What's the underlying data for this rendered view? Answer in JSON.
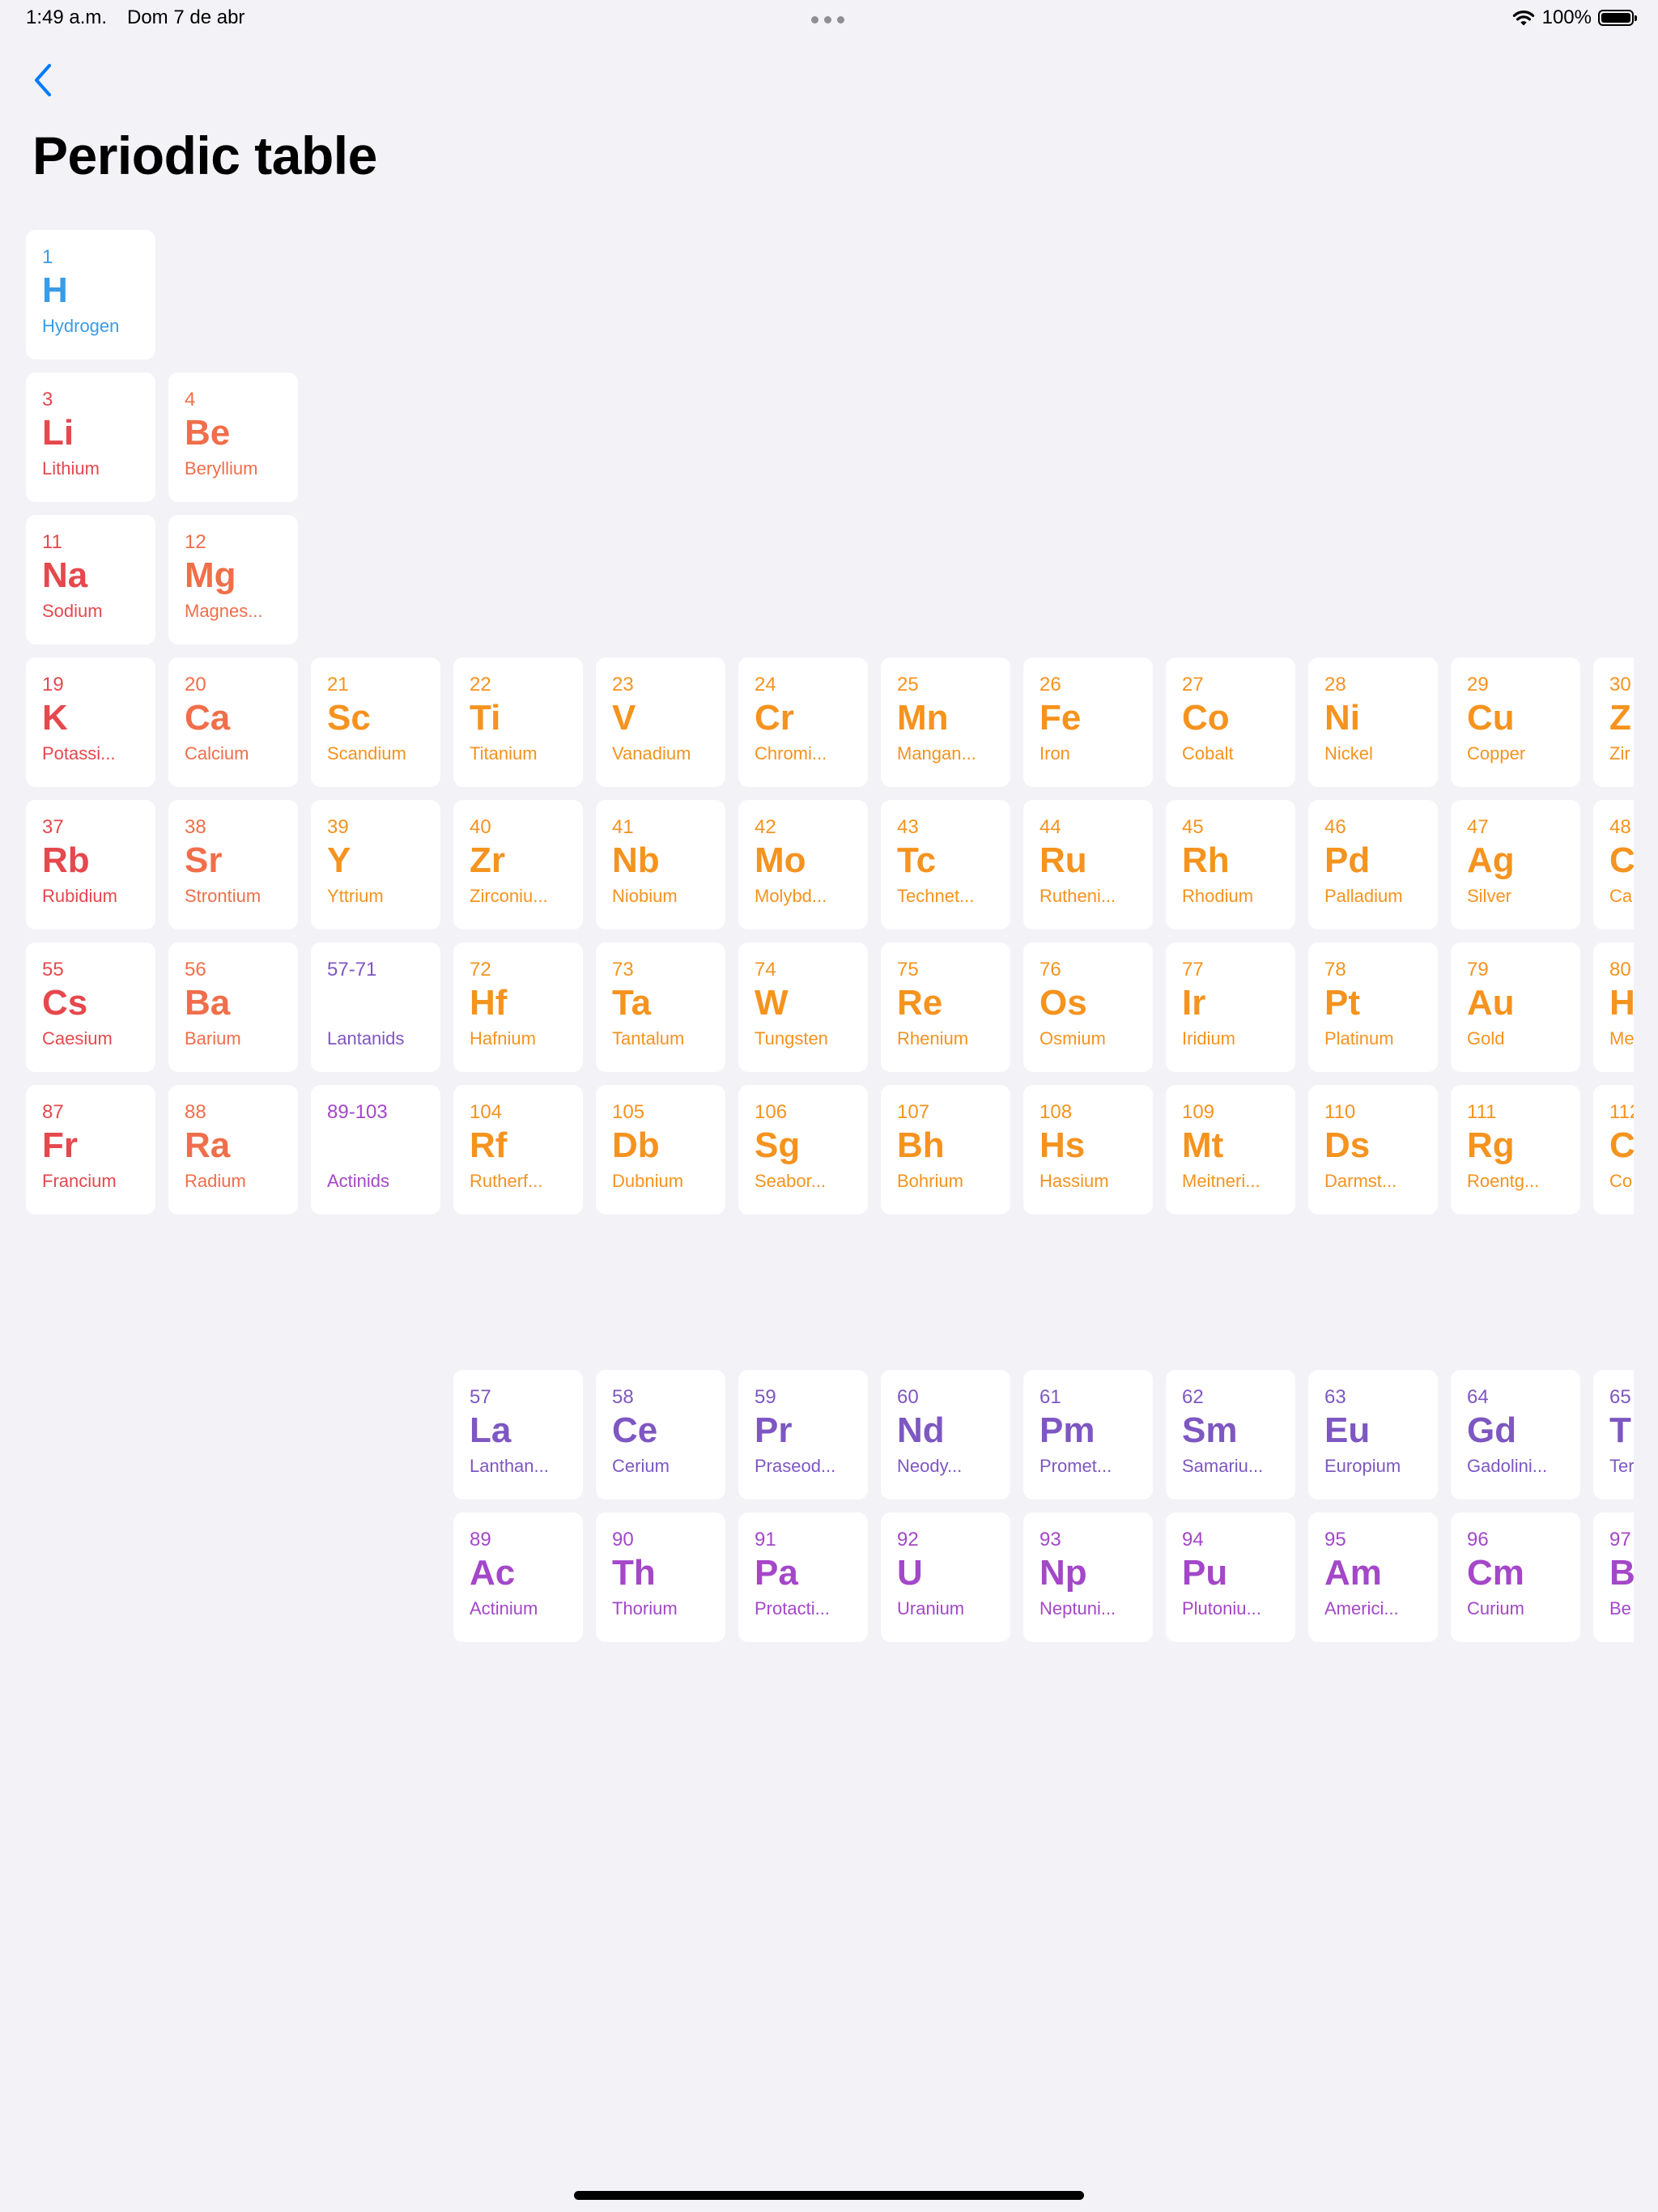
{
  "status_bar": {
    "time": "1:49 a.m.",
    "date": "Dom 7 de abr",
    "battery": "100%"
  },
  "header": {
    "title": "Periodic table",
    "back_icon": "chevron-left-icon"
  },
  "colors": {
    "background": "#f2f2f7",
    "tile": "#ffffff",
    "accent": "#007aff",
    "hydrogen": "#3a9be6",
    "alkali": "#e5484d",
    "alkaline_earth": "#f06e4a",
    "transition": "#f5931f",
    "lanthanide": "#7e57c2",
    "actinide": "#a447c9"
  },
  "elements": [
    {
      "row": 1,
      "col": 1,
      "num": "1",
      "sym": "H",
      "name": "Hydrogen",
      "group": "hydrogen"
    },
    {
      "row": 2,
      "col": 1,
      "num": "3",
      "sym": "Li",
      "name": "Lithium",
      "group": "alkali"
    },
    {
      "row": 2,
      "col": 2,
      "num": "4",
      "sym": "Be",
      "name": "Beryllium",
      "group": "alkaline_earth"
    },
    {
      "row": 3,
      "col": 1,
      "num": "11",
      "sym": "Na",
      "name": "Sodium",
      "group": "alkali"
    },
    {
      "row": 3,
      "col": 2,
      "num": "12",
      "sym": "Mg",
      "name": "Magnes...",
      "group": "alkaline_earth"
    },
    {
      "row": 4,
      "col": 1,
      "num": "19",
      "sym": "K",
      "name": "Potassi...",
      "group": "alkali"
    },
    {
      "row": 4,
      "col": 2,
      "num": "20",
      "sym": "Ca",
      "name": "Calcium",
      "group": "alkaline_earth"
    },
    {
      "row": 4,
      "col": 3,
      "num": "21",
      "sym": "Sc",
      "name": "Scandium",
      "group": "transition"
    },
    {
      "row": 4,
      "col": 4,
      "num": "22",
      "sym": "Ti",
      "name": "Titanium",
      "group": "transition"
    },
    {
      "row": 4,
      "col": 5,
      "num": "23",
      "sym": "V",
      "name": "Vanadium",
      "group": "transition"
    },
    {
      "row": 4,
      "col": 6,
      "num": "24",
      "sym": "Cr",
      "name": "Chromi...",
      "group": "transition"
    },
    {
      "row": 4,
      "col": 7,
      "num": "25",
      "sym": "Mn",
      "name": "Mangan...",
      "group": "transition"
    },
    {
      "row": 4,
      "col": 8,
      "num": "26",
      "sym": "Fe",
      "name": "Iron",
      "group": "transition"
    },
    {
      "row": 4,
      "col": 9,
      "num": "27",
      "sym": "Co",
      "name": "Cobalt",
      "group": "transition"
    },
    {
      "row": 4,
      "col": 10,
      "num": "28",
      "sym": "Ni",
      "name": "Nickel",
      "group": "transition"
    },
    {
      "row": 4,
      "col": 11,
      "num": "29",
      "sym": "Cu",
      "name": "Copper",
      "group": "transition"
    },
    {
      "row": 4,
      "col": 12,
      "num": "30",
      "sym": "Z",
      "name": "Zir",
      "group": "transition"
    },
    {
      "row": 5,
      "col": 1,
      "num": "37",
      "sym": "Rb",
      "name": "Rubidium",
      "group": "alkali"
    },
    {
      "row": 5,
      "col": 2,
      "num": "38",
      "sym": "Sr",
      "name": "Strontium",
      "group": "alkaline_earth"
    },
    {
      "row": 5,
      "col": 3,
      "num": "39",
      "sym": "Y",
      "name": "Yttrium",
      "group": "transition"
    },
    {
      "row": 5,
      "col": 4,
      "num": "40",
      "sym": "Zr",
      "name": "Zirconiu...",
      "group": "transition"
    },
    {
      "row": 5,
      "col": 5,
      "num": "41",
      "sym": "Nb",
      "name": "Niobium",
      "group": "transition"
    },
    {
      "row": 5,
      "col": 6,
      "num": "42",
      "sym": "Mo",
      "name": "Molybd...",
      "group": "transition"
    },
    {
      "row": 5,
      "col": 7,
      "num": "43",
      "sym": "Tc",
      "name": "Technet...",
      "group": "transition"
    },
    {
      "row": 5,
      "col": 8,
      "num": "44",
      "sym": "Ru",
      "name": "Rutheni...",
      "group": "transition"
    },
    {
      "row": 5,
      "col": 9,
      "num": "45",
      "sym": "Rh",
      "name": "Rhodium",
      "group": "transition"
    },
    {
      "row": 5,
      "col": 10,
      "num": "46",
      "sym": "Pd",
      "name": "Palladium",
      "group": "transition"
    },
    {
      "row": 5,
      "col": 11,
      "num": "47",
      "sym": "Ag",
      "name": "Silver",
      "group": "transition"
    },
    {
      "row": 5,
      "col": 12,
      "num": "48",
      "sym": "C",
      "name": "Ca",
      "group": "transition"
    },
    {
      "row": 6,
      "col": 1,
      "num": "55",
      "sym": "Cs",
      "name": "Caesium",
      "group": "alkali"
    },
    {
      "row": 6,
      "col": 2,
      "num": "56",
      "sym": "Ba",
      "name": "Barium",
      "group": "alkaline_earth"
    },
    {
      "row": 6,
      "col": 3,
      "num": "57-71",
      "sym": "",
      "name": "Lantanids",
      "group": "lanthanide"
    },
    {
      "row": 6,
      "col": 4,
      "num": "72",
      "sym": "Hf",
      "name": "Hafnium",
      "group": "transition"
    },
    {
      "row": 6,
      "col": 5,
      "num": "73",
      "sym": "Ta",
      "name": "Tantalum",
      "group": "transition"
    },
    {
      "row": 6,
      "col": 6,
      "num": "74",
      "sym": "W",
      "name": "Tungsten",
      "group": "transition"
    },
    {
      "row": 6,
      "col": 7,
      "num": "75",
      "sym": "Re",
      "name": "Rhenium",
      "group": "transition"
    },
    {
      "row": 6,
      "col": 8,
      "num": "76",
      "sym": "Os",
      "name": "Osmium",
      "group": "transition"
    },
    {
      "row": 6,
      "col": 9,
      "num": "77",
      "sym": "Ir",
      "name": "Iridium",
      "group": "transition"
    },
    {
      "row": 6,
      "col": 10,
      "num": "78",
      "sym": "Pt",
      "name": "Platinum",
      "group": "transition"
    },
    {
      "row": 6,
      "col": 11,
      "num": "79",
      "sym": "Au",
      "name": "Gold",
      "group": "transition"
    },
    {
      "row": 6,
      "col": 12,
      "num": "80",
      "sym": "H",
      "name": "Me",
      "group": "transition"
    },
    {
      "row": 7,
      "col": 1,
      "num": "87",
      "sym": "Fr",
      "name": "Francium",
      "group": "alkali"
    },
    {
      "row": 7,
      "col": 2,
      "num": "88",
      "sym": "Ra",
      "name": "Radium",
      "group": "alkaline_earth"
    },
    {
      "row": 7,
      "col": 3,
      "num": "89-103",
      "sym": "",
      "name": "Actinids",
      "group": "actinide"
    },
    {
      "row": 7,
      "col": 4,
      "num": "104",
      "sym": "Rf",
      "name": "Rutherf...",
      "group": "transition"
    },
    {
      "row": 7,
      "col": 5,
      "num": "105",
      "sym": "Db",
      "name": "Dubnium",
      "group": "transition"
    },
    {
      "row": 7,
      "col": 6,
      "num": "106",
      "sym": "Sg",
      "name": "Seabor...",
      "group": "transition"
    },
    {
      "row": 7,
      "col": 7,
      "num": "107",
      "sym": "Bh",
      "name": "Bohrium",
      "group": "transition"
    },
    {
      "row": 7,
      "col": 8,
      "num": "108",
      "sym": "Hs",
      "name": "Hassium",
      "group": "transition"
    },
    {
      "row": 7,
      "col": 9,
      "num": "109",
      "sym": "Mt",
      "name": "Meitneri...",
      "group": "transition"
    },
    {
      "row": 7,
      "col": 10,
      "num": "110",
      "sym": "Ds",
      "name": "Darmst...",
      "group": "transition"
    },
    {
      "row": 7,
      "col": 11,
      "num": "111",
      "sym": "Rg",
      "name": "Roentg...",
      "group": "transition"
    },
    {
      "row": 7,
      "col": 12,
      "num": "112",
      "sym": "C",
      "name": "Co",
      "group": "transition"
    },
    {
      "row": 9,
      "col": 4,
      "num": "57",
      "sym": "La",
      "name": "Lanthan...",
      "group": "lanthanide"
    },
    {
      "row": 9,
      "col": 5,
      "num": "58",
      "sym": "Ce",
      "name": "Cerium",
      "group": "lanthanide"
    },
    {
      "row": 9,
      "col": 6,
      "num": "59",
      "sym": "Pr",
      "name": "Praseod...",
      "group": "lanthanide"
    },
    {
      "row": 9,
      "col": 7,
      "num": "60",
      "sym": "Nd",
      "name": "Neody...",
      "group": "lanthanide"
    },
    {
      "row": 9,
      "col": 8,
      "num": "61",
      "sym": "Pm",
      "name": "Promet...",
      "group": "lanthanide"
    },
    {
      "row": 9,
      "col": 9,
      "num": "62",
      "sym": "Sm",
      "name": "Samariu...",
      "group": "lanthanide"
    },
    {
      "row": 9,
      "col": 10,
      "num": "63",
      "sym": "Eu",
      "name": "Europium",
      "group": "lanthanide"
    },
    {
      "row": 9,
      "col": 11,
      "num": "64",
      "sym": "Gd",
      "name": "Gadolini...",
      "group": "lanthanide"
    },
    {
      "row": 9,
      "col": 12,
      "num": "65",
      "sym": "T",
      "name": "Ter",
      "group": "lanthanide"
    },
    {
      "row": 10,
      "col": 4,
      "num": "89",
      "sym": "Ac",
      "name": "Actinium",
      "group": "actinide"
    },
    {
      "row": 10,
      "col": 5,
      "num": "90",
      "sym": "Th",
      "name": "Thorium",
      "group": "actinide"
    },
    {
      "row": 10,
      "col": 6,
      "num": "91",
      "sym": "Pa",
      "name": "Protacti...",
      "group": "actinide"
    },
    {
      "row": 10,
      "col": 7,
      "num": "92",
      "sym": "U",
      "name": "Uranium",
      "group": "actinide"
    },
    {
      "row": 10,
      "col": 8,
      "num": "93",
      "sym": "Np",
      "name": "Neptuni...",
      "group": "actinide"
    },
    {
      "row": 10,
      "col": 9,
      "num": "94",
      "sym": "Pu",
      "name": "Plutoniu...",
      "group": "actinide"
    },
    {
      "row": 10,
      "col": 10,
      "num": "95",
      "sym": "Am",
      "name": "Americi...",
      "group": "actinide"
    },
    {
      "row": 10,
      "col": 11,
      "num": "96",
      "sym": "Cm",
      "name": "Curium",
      "group": "actinide"
    },
    {
      "row": 10,
      "col": 12,
      "num": "97",
      "sym": "B",
      "name": "Be",
      "group": "actinide"
    }
  ]
}
